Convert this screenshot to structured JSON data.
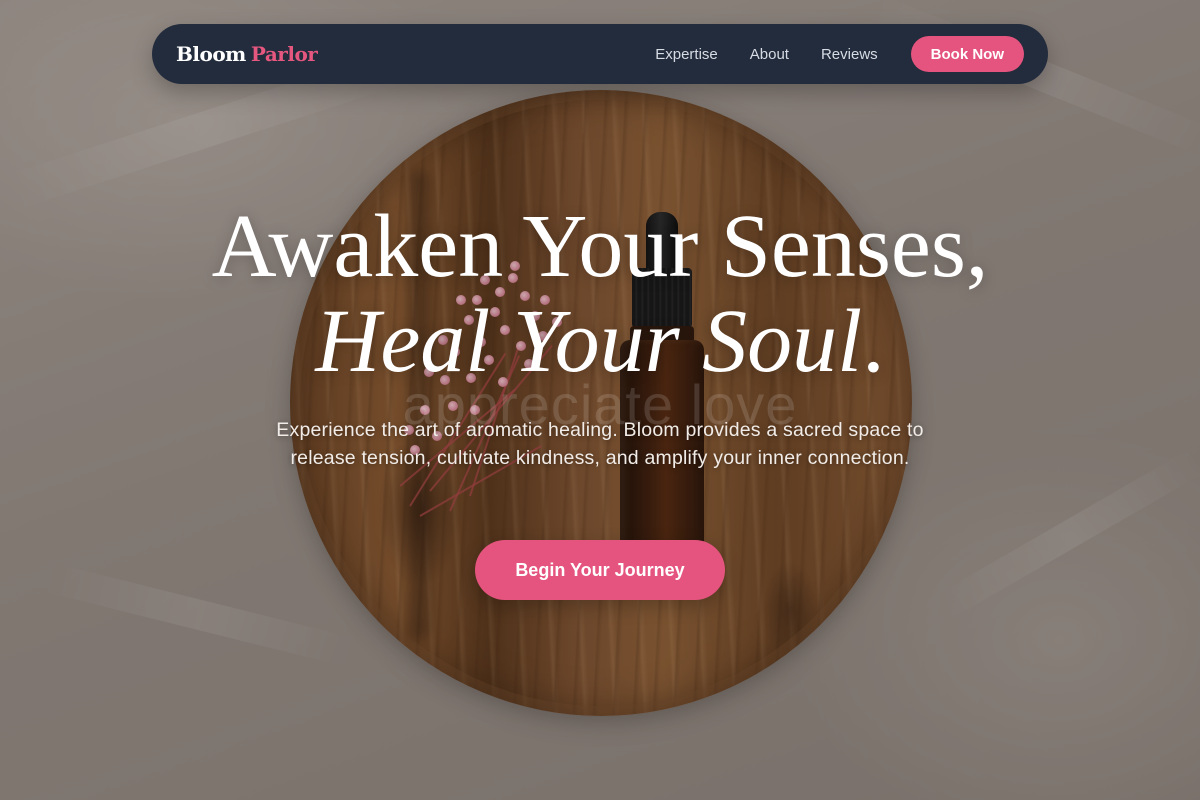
{
  "brand": {
    "first": "Bloom",
    "second": "Parlor"
  },
  "nav": {
    "links": [
      "Expertise",
      "About",
      "Reviews"
    ],
    "cta_label": "Book Now"
  },
  "hero": {
    "headline_line1": "Awaken Your Senses,",
    "headline_line2": "Heal Your Soul",
    "headline_period": ".",
    "watermark": "appreciate love",
    "tagline": "Experience the art of aromatic healing. Bloom provides a sacred space to release tension, cultivate kindness, and amplify your inner connection.",
    "cta_label": "Begin Your Journey"
  },
  "colors": {
    "nav_background": "#222c3d",
    "accent": "#e5547f",
    "brand_accent": "#e5577f",
    "nav_link": "#d7dbe3",
    "text_light": "#ffffff"
  },
  "icons": [
    "essential-oil-bottle-image",
    "wooden-plate-image",
    "dried-flowers-image"
  ]
}
